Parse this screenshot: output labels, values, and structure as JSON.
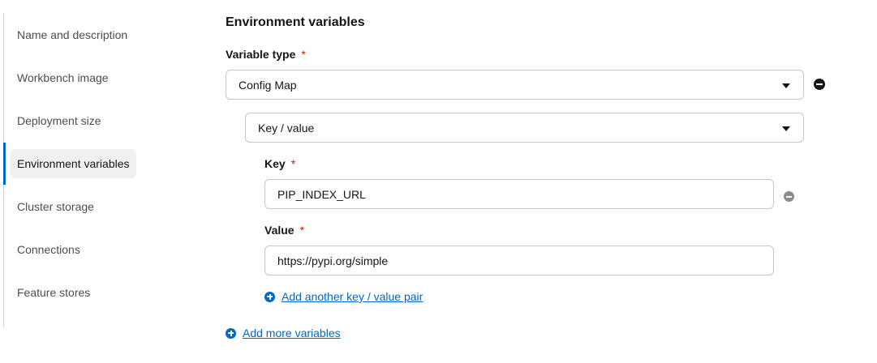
{
  "sidebar": {
    "items": [
      {
        "label": "Name and description"
      },
      {
        "label": "Workbench image"
      },
      {
        "label": "Deployment size"
      },
      {
        "label": "Environment variables",
        "active": true
      },
      {
        "label": "Cluster storage"
      },
      {
        "label": "Connections"
      },
      {
        "label": "Feature stores"
      }
    ]
  },
  "main": {
    "section_title": "Environment variables",
    "variable_type": {
      "label": "Variable type",
      "required_marker": "*",
      "selected": "Config Map"
    },
    "config_type": {
      "selected": "Key / value"
    },
    "key_field": {
      "label": "Key",
      "required_marker": "*",
      "value": "PIP_INDEX_URL"
    },
    "value_field": {
      "label": "Value",
      "required_marker": "*",
      "value": "https://pypi.org/simple"
    },
    "add_pair_label": "Add another key / value pair",
    "add_variables_label": "Add more variables"
  },
  "colors": {
    "accent": "#0066cc",
    "required": "#c9190b",
    "remove_variable_icon": "#151515",
    "remove_pair_icon": "#8a8d90"
  },
  "icons": {
    "remove_variable": "minus-circle-icon",
    "remove_pair": "minus-circle-icon",
    "add": "plus-circle-icon",
    "dropdown": "caret-down-icon"
  }
}
